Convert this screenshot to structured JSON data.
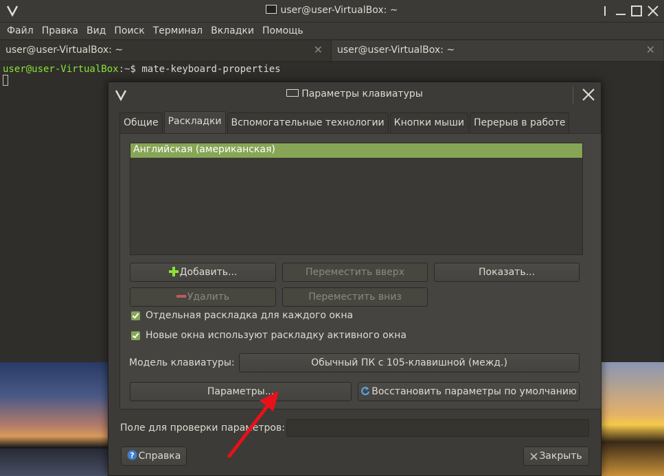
{
  "terminal": {
    "title": "user@user-VirtualBox: ~",
    "menu": [
      "Файл",
      "Правка",
      "Вид",
      "Поиск",
      "Терминал",
      "Вкладки",
      "Помощь"
    ],
    "tabs": [
      {
        "label": "user@user-VirtualBox: ~"
      },
      {
        "label": "user@user-VirtualBox: ~"
      }
    ],
    "prompt_user": "user@user-VirtualBox",
    "prompt_sep": ":",
    "prompt_path": "~",
    "prompt_symbol": "$",
    "command": " mate-keyboard-properties"
  },
  "dialog": {
    "title": "Параметры клавиатуры",
    "tabs": [
      "Общие",
      "Раскладки",
      "Вспомогательные технологии",
      "Кнопки мыши",
      "Перерыв в работе"
    ],
    "active_tab": "Раскладки",
    "layouts": [
      "Английская (американская)"
    ],
    "buttons": {
      "add": "Добавить...",
      "move_up": "Переместить вверх",
      "show": "Показать...",
      "remove": "Удалить",
      "move_down": "Переместить вниз",
      "model": "Обычный ПК с 105-клавишной (межд.)",
      "options": "Параметры...",
      "reset": "Восстановить параметры по умолчанию",
      "help": "Справка",
      "close": "Закрыть"
    },
    "checks": [
      {
        "label": "Отдельная раскладка для каждого окна",
        "checked": true
      },
      {
        "label": "Новые окна используют раскладку активного окна",
        "checked": true
      }
    ],
    "model_label": "Модель клавиатуры:",
    "test_label": "Поле для проверки параметров:",
    "test_value": ""
  },
  "colors": {
    "accent": "#87a556",
    "annotation_arrow": "#e8111a"
  }
}
